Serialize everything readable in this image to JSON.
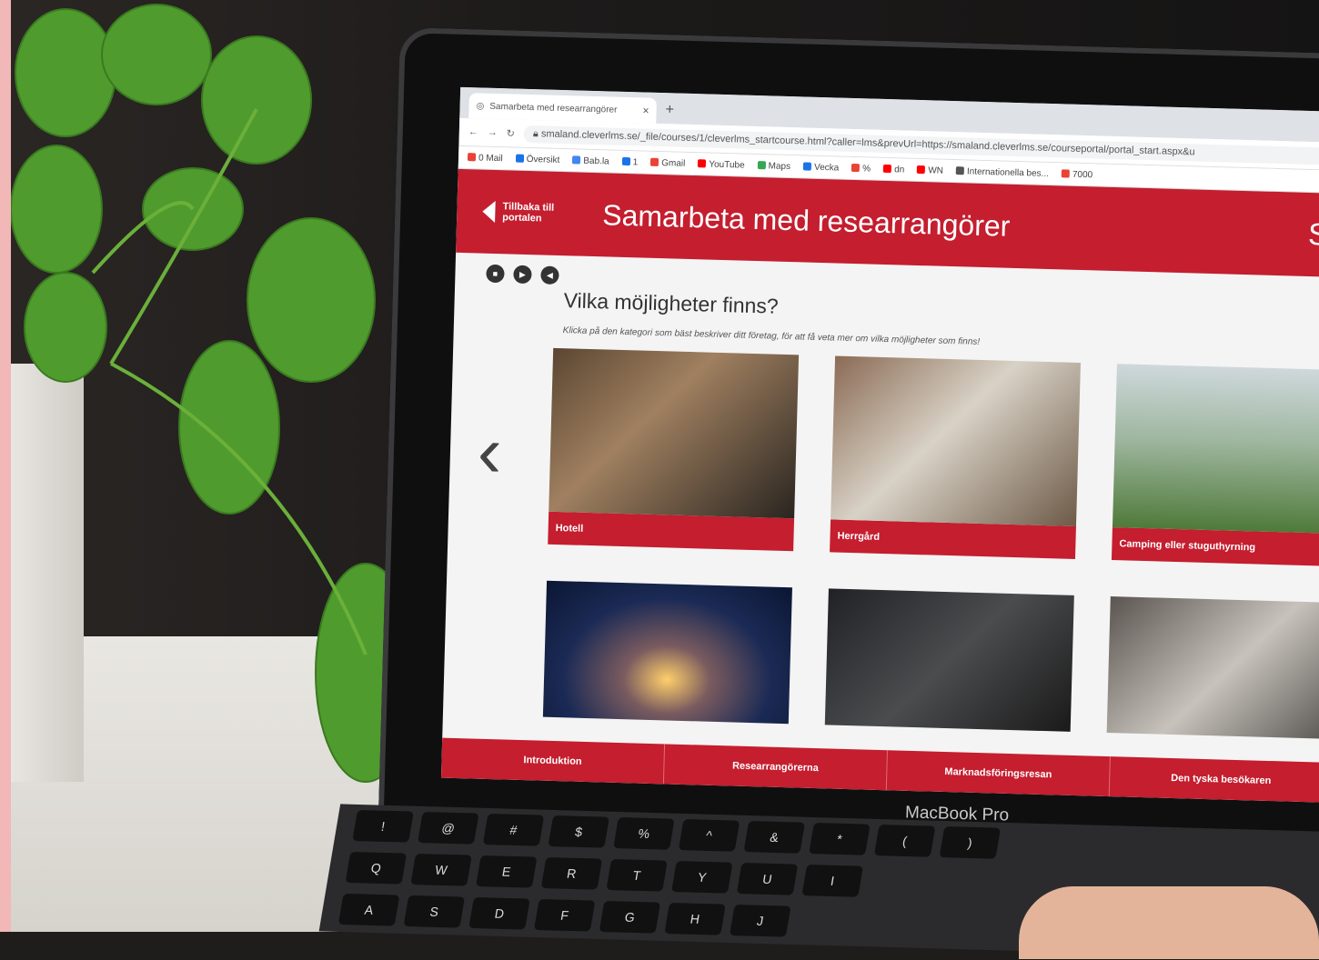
{
  "browser": {
    "tab_title": "Samarbeta med researrangörer",
    "new_tab": "+",
    "url": "smaland.cleverlms.se/_file/courses/1/cleverlms_startcourse.html?caller=lms&prevUrl=https://smaland.cleverlms.se/courseportal/portal_start.aspx&u",
    "bookmarks": [
      {
        "label": "0 Mail",
        "color": "#ea4335"
      },
      {
        "label": "Översikt",
        "color": "#1a73e8"
      },
      {
        "label": "Bab.la",
        "color": "#4285f4"
      },
      {
        "label": "1",
        "color": "#1a73e8"
      },
      {
        "label": "Gmail",
        "color": "#ea4335"
      },
      {
        "label": "YouTube",
        "color": "#ff0000"
      },
      {
        "label": "Maps",
        "color": "#34a853"
      },
      {
        "label": "Vecka",
        "color": "#1a73e8"
      },
      {
        "label": "%",
        "color": "#ea4335"
      },
      {
        "label": "dn",
        "color": "#ff0000"
      },
      {
        "label": "WN",
        "color": "#ff0000"
      },
      {
        "label": "Internationella bes...",
        "color": "#555555"
      },
      {
        "label": "7000",
        "color": "#ea4335"
      }
    ]
  },
  "course": {
    "back_label": "Tillbaka till portalen",
    "title": "Samarbeta med researrangörer",
    "brand_partial": "Sr",
    "accent": "#c41e2f"
  },
  "content": {
    "heading": "Vilka möjligheter finns?",
    "instruction": "Klicka på den kategori som bäst beskriver ditt företag, för att få veta mer om vilka möjligheter som finns!",
    "cards": [
      {
        "label": "Hotell",
        "image": "hotel-reception"
      },
      {
        "label": "Herrgård",
        "image": "manor-dining-room"
      },
      {
        "label": "Camping eller stuguthyrning",
        "image": "campsite"
      },
      {
        "label": "",
        "image": "glamping-tent"
      },
      {
        "label": "",
        "image": "restaurant-kitchen"
      },
      {
        "label": "",
        "image": "workshop"
      }
    ]
  },
  "bottom_nav": [
    "Introduktion",
    "Researrangörerna",
    "Marknadsföringsresan",
    "Den tyska besökaren"
  ],
  "laptop": {
    "brand": "MacBook Pro"
  },
  "keyboard": {
    "row1": [
      "!",
      "@",
      "#",
      "$",
      "%",
      "^",
      "&",
      "*",
      "(",
      ")"
    ],
    "row2": [
      "Q",
      "W",
      "E",
      "R",
      "T",
      "Y",
      "U",
      "I"
    ],
    "row3": [
      "A",
      "S",
      "D",
      "F",
      "G",
      "H",
      "J"
    ]
  }
}
